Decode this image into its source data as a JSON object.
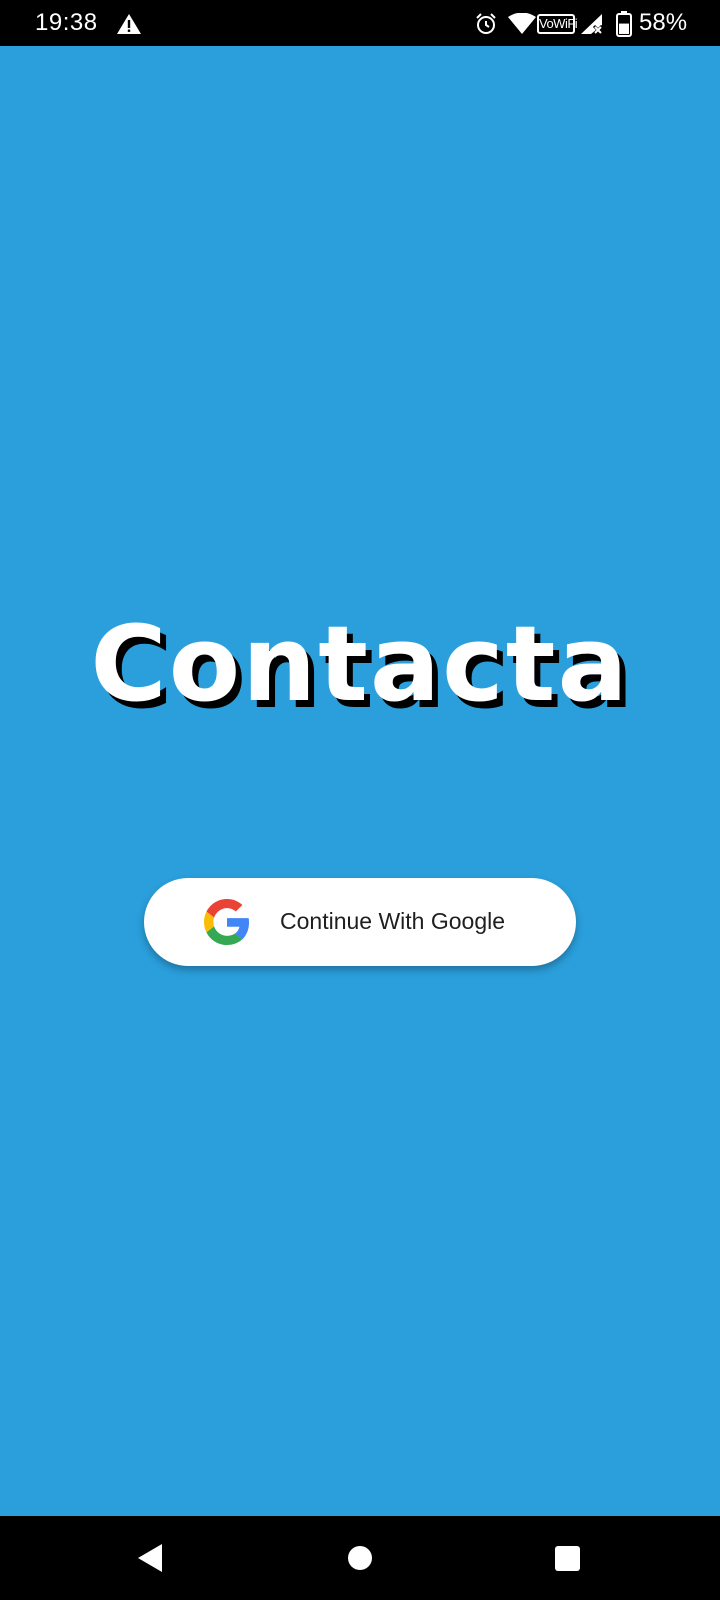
{
  "status_bar": {
    "time": "19:38",
    "vowifi_label": "VoWiFi",
    "battery_percent": "58%",
    "battery_level": 0.58,
    "icons": [
      "warning-icon",
      "alarm-icon",
      "wifi-icon",
      "vowifi-badge",
      "signal-no-service-icon",
      "battery-icon"
    ]
  },
  "app": {
    "title": "Contacta",
    "background_color": "#2a9fdc"
  },
  "login": {
    "google_button_label": "Continue With Google",
    "google_icon": "google-g-logo"
  },
  "nav_bar": {
    "buttons": [
      "back",
      "home",
      "recents"
    ]
  }
}
